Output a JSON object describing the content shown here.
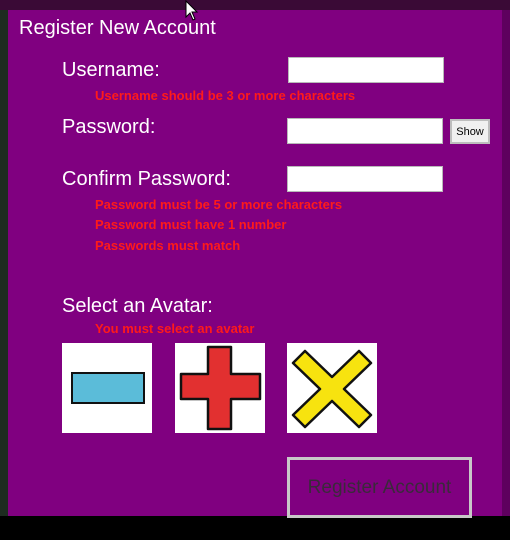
{
  "window": {
    "title": "Register New Account"
  },
  "form": {
    "username_label": "Username:",
    "username_error": "Username should be 3 or more characters",
    "password_label": "Password:",
    "show_label": "Show",
    "confirm_label": "Confirm Password:",
    "password_errors": [
      "Password must be 5 or more characters",
      "Password must have 1 number",
      "Passwords must match"
    ],
    "avatar_label": "Select an Avatar:",
    "avatar_error": "You must select an avatar",
    "avatars": [
      "minus-shape",
      "plus-shape",
      "x-shape"
    ],
    "register_label": "Register Account"
  },
  "colors": {
    "panel": "#800080",
    "error": "#ff1a1a",
    "avatar_minus": "#5bbcd9",
    "avatar_plus": "#e23030",
    "avatar_x": "#f7e30f"
  }
}
